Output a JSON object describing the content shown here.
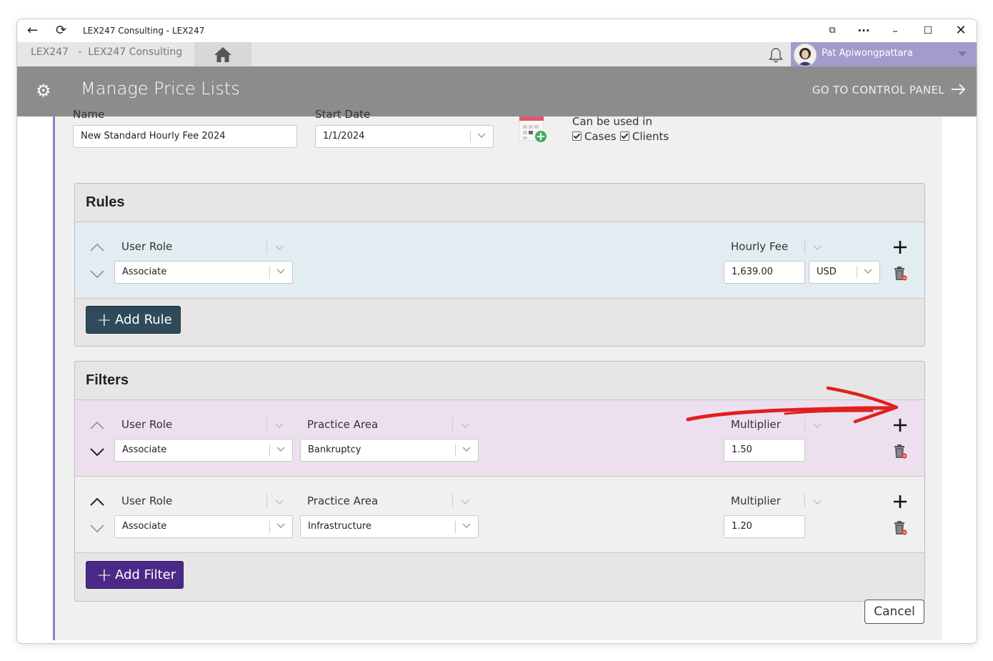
{
  "window": {
    "title": "LEX247 Consulting - LEX247"
  },
  "appbar": {
    "breadcrumb": "LEX247   -  LEX247 Consulting",
    "user_name": "Pat Apiwongpattara"
  },
  "header": {
    "title": "Manage Price Lists",
    "control_panel": "GO TO CONTROL PANEL"
  },
  "form": {
    "name_label": "Name",
    "name_value": "New Standard Hourly Fee 2024",
    "start_date_label": "Start Date",
    "start_date_value": "1/1/2024",
    "usage_label": "Can be used in",
    "usage_cases": "Cases",
    "usage_clients": "Clients"
  },
  "rules": {
    "title": "Rules",
    "rows": [
      {
        "role_label": "User Role",
        "role_value": "Associate",
        "fee_label": "Hourly Fee",
        "fee_value": "1,639.00",
        "currency": "USD"
      }
    ],
    "add_label": "Add Rule"
  },
  "filters": {
    "title": "Filters",
    "rows": [
      {
        "role_label": "User Role",
        "role_value": "Associate",
        "area_label": "Practice Area",
        "area_value": "Bankruptcy",
        "mult_label": "Multiplier",
        "mult_value": "1.50"
      },
      {
        "role_label": "User Role",
        "role_value": "Associate",
        "area_label": "Practice Area",
        "area_value": "Infrastructure",
        "mult_label": "Multiplier",
        "mult_value": "1.20"
      }
    ],
    "add_label": "Add Filter"
  },
  "footer": {
    "cancel_label": "Cancel"
  },
  "colors": {
    "header_bg": "#8c8c8c",
    "user_bg": "#a29bcc",
    "rule_row_bg": "#e2ecf1",
    "filter_row_highlight": "#ece0ee",
    "add_rule_btn": "#2f4a59",
    "add_filter_btn": "#4a2a86",
    "annotation_arrow": "#e0201e"
  }
}
